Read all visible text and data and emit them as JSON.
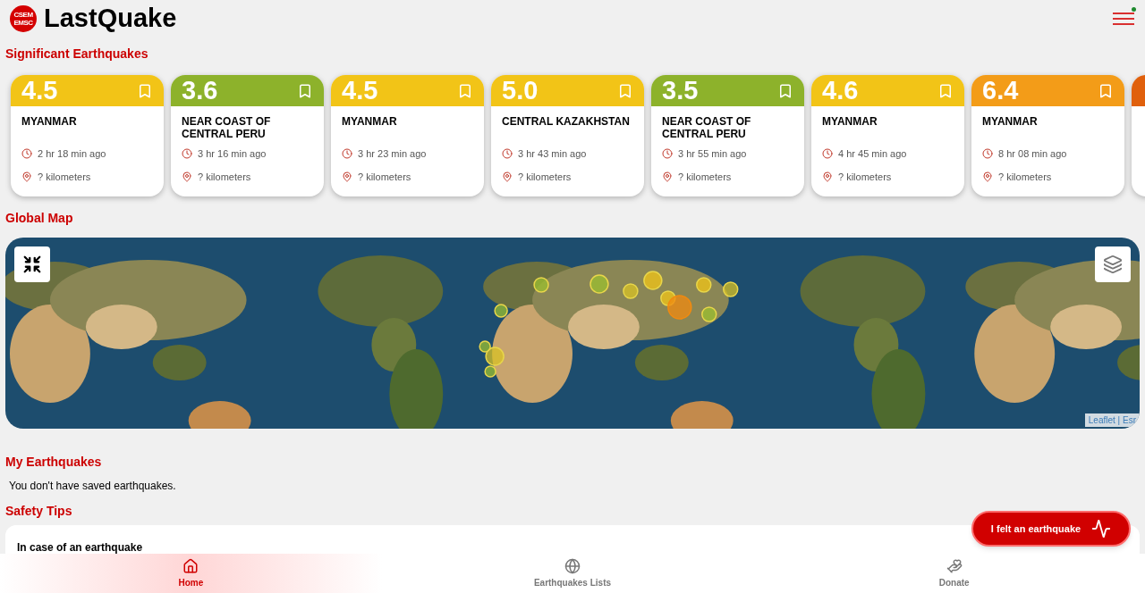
{
  "header": {
    "logo_text": [
      "CSEM",
      "EMSC"
    ],
    "title": "LastQuake",
    "menu_notification": true
  },
  "significant": {
    "title": "Significant Earthquakes",
    "cards": [
      {
        "kind": "full",
        "magnitude": "4.5",
        "color": "#f2c417",
        "region": "MYANMAR",
        "time": "2 hr 18 min ago",
        "distance": "? kilometers",
        "saved": false
      },
      {
        "kind": "full",
        "magnitude": "3.6",
        "color": "#8db22b",
        "region": "NEAR COAST OF CENTRAL PERU",
        "time": "3 hr 16 min ago",
        "distance": "? kilometers",
        "saved": false
      },
      {
        "kind": "full",
        "magnitude": "4.5",
        "color": "#f2c417",
        "region": "MYANMAR",
        "time": "3 hr 23 min ago",
        "distance": "? kilometers",
        "saved": false
      },
      {
        "kind": "full",
        "magnitude": "5.0",
        "color": "#f2c417",
        "region": "CENTRAL KAZAKHSTAN",
        "time": "3 hr 43 min ago",
        "distance": "? kilometers",
        "saved": false
      },
      {
        "kind": "full",
        "magnitude": "3.5",
        "color": "#8db22b",
        "region": "NEAR COAST OF CENTRAL PERU",
        "time": "3 hr 55 min ago",
        "distance": "? kilometers",
        "saved": false
      },
      {
        "kind": "full",
        "magnitude": "4.6",
        "color": "#f2c417",
        "region": "MYANMAR",
        "time": "4 hr 45 min ago",
        "distance": "? kilometers",
        "saved": false
      },
      {
        "kind": "full",
        "magnitude": "6.4",
        "color": "#f39c18",
        "region": "MYANMAR",
        "time": "8 hr 08 min ago",
        "distance": "? kilometers",
        "saved": false
      },
      {
        "kind": "partial",
        "color": "#e0600c"
      }
    ]
  },
  "map": {
    "title": "Global Map",
    "attribution": "Leaflet | Esr"
  },
  "my_earthquakes": {
    "title": "My Earthquakes",
    "message": "You don't have saved earthquakes."
  },
  "safety": {
    "title": "Safety Tips",
    "card_title": "In case of an earthquake"
  },
  "felt_button": "I felt an earthquake",
  "nav": [
    {
      "label": "Home",
      "selected": true
    },
    {
      "label": "Earthquakes Lists",
      "selected": false
    },
    {
      "label": "Donate",
      "selected": false
    }
  ]
}
